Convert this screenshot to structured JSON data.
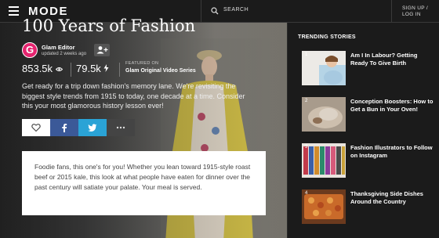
{
  "header": {
    "logo": "MODE",
    "search_label": "SEARCH",
    "signup_line1": "SIGN UP /",
    "signup_line2": "LOG IN"
  },
  "article": {
    "title": "100 Years of Fashion",
    "author": {
      "initial": "G",
      "name": "Glam Editor",
      "updated": "updated 2 weeks ago"
    },
    "stats": {
      "views": "853.5k",
      "hearts": "79.5k"
    },
    "featured_label": "FEATURED ON",
    "featured_series": "Glam Original Video Series",
    "description": "Get ready for a trip down fashion's memory lane. We're revisiting the biggest style trends from 1915 to today, one decade at a time. Consider this your most glamorous history lesson ever!",
    "body": "Foodie fans, this one's for you! Whether you lean toward 1915-style roast beef or 2015 kale, this look at what people have eaten for dinner over the past century will satiate your palate. Your meal is served."
  },
  "sidebar": {
    "heading": "TRENDING STORIES",
    "stories": [
      {
        "num": "1",
        "title": "Am I In Labour? Getting Ready To Give Birth"
      },
      {
        "num": "2",
        "title": "Conception Boosters: How to Get a Bun in Your Oven!"
      },
      {
        "num": "3",
        "title": "Fashion Illustrators to Follow on Instagram"
      },
      {
        "num": "4",
        "title": "Thanksgiving Side Dishes Around the Country"
      }
    ]
  },
  "colors": {
    "accent_avatar": "#e5246f",
    "facebook": "#3b5998",
    "twitter": "#2aa3d6"
  }
}
